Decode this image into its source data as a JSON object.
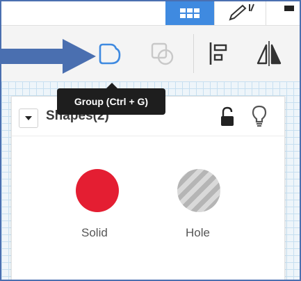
{
  "tooltip": {
    "text": "Group (Ctrl + G)"
  },
  "toolbar": {
    "buttons": [
      {
        "name": "group",
        "icon": "group-icon",
        "highlighted": true
      },
      {
        "name": "ungroup",
        "icon": "ungroup-icon",
        "disabled": true
      },
      {
        "name": "align",
        "icon": "align-icon"
      },
      {
        "name": "mirror",
        "icon": "mirror-icon"
      }
    ]
  },
  "views": [
    {
      "icon": "grid-view-icon",
      "active": true
    },
    {
      "icon": "pencil-icon",
      "active": false
    },
    {
      "icon": "list-view-icon",
      "active": false
    }
  ],
  "panel": {
    "title": "Shapes(2)",
    "solid": {
      "label": "Solid",
      "color": "#e41e32"
    },
    "hole": {
      "label": "Hole",
      "color": "#b5b5b5"
    }
  },
  "colors": {
    "accent": "#3f8ae0",
    "annotation_arrow": "#4a6fb0"
  }
}
